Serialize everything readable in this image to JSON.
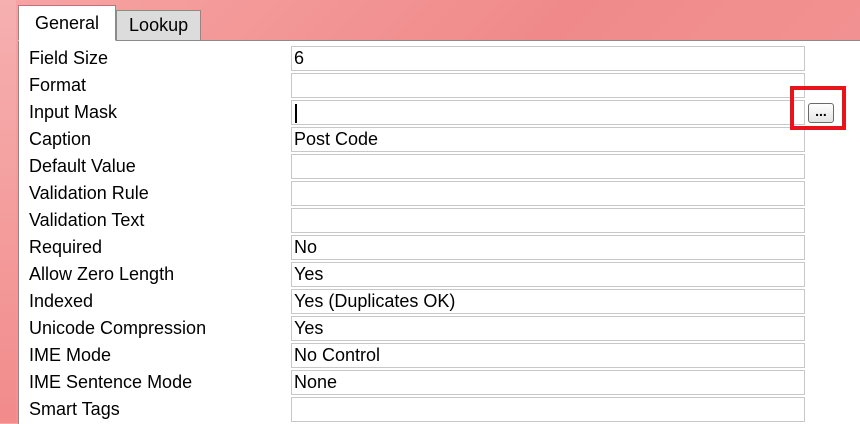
{
  "tabs": [
    {
      "label": "General",
      "active": true
    },
    {
      "label": "Lookup",
      "active": false
    }
  ],
  "properties": [
    {
      "label": "Field Size",
      "value": "6"
    },
    {
      "label": "Format",
      "value": ""
    },
    {
      "label": "Input Mask",
      "value": ""
    },
    {
      "label": "Caption",
      "value": "Post Code"
    },
    {
      "label": "Default Value",
      "value": ""
    },
    {
      "label": "Validation Rule",
      "value": ""
    },
    {
      "label": "Validation Text",
      "value": ""
    },
    {
      "label": "Required",
      "value": "No"
    },
    {
      "label": "Allow Zero Length",
      "value": "Yes"
    },
    {
      "label": "Indexed",
      "value": "Yes (Duplicates OK)"
    },
    {
      "label": "Unicode Compression",
      "value": "Yes"
    },
    {
      "label": "IME Mode",
      "value": "No Control"
    },
    {
      "label": "IME Sentence Mode",
      "value": "None"
    },
    {
      "label": "Smart Tags",
      "value": ""
    }
  ],
  "build_button": {
    "label": "...",
    "icon": "ellipsis-icon"
  },
  "colors": {
    "highlight": "#e8141b",
    "panel_bg": "#ffffff",
    "border": "#8a8a8a"
  }
}
